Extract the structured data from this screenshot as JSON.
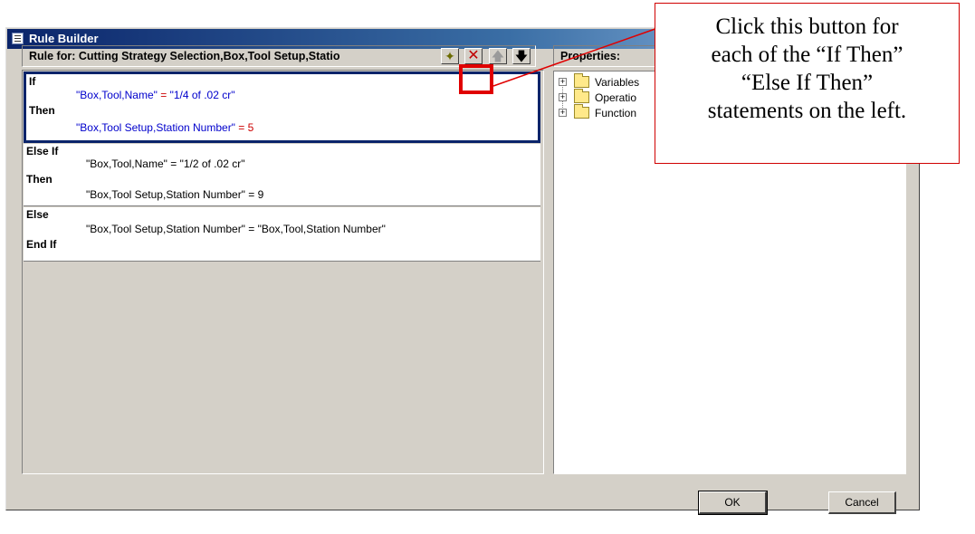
{
  "window": {
    "title": "Rule Builder"
  },
  "rule_panel": {
    "header": "Rule for: Cutting Strategy Selection,Box,Tool Setup,Statio",
    "toolbar": {
      "new_icon": "new-rule-icon",
      "delete_icon": "delete-x-icon",
      "move_up_icon": "arrow-up-icon",
      "move_down_icon": "arrow-down-icon"
    },
    "blocks": [
      {
        "keyword1": "If",
        "cond_lhs": "\"Box,Tool,Name\"",
        "cond_eq": " = ",
        "cond_rhs": "\"1/4 of .02 cr\"",
        "keyword2": "Then",
        "action_lhs": "\"Box,Tool Setup,Station Number\"",
        "action_eq": " = ",
        "action_rhs": "5"
      },
      {
        "keyword1": "Else If",
        "condition": "\"Box,Tool,Name\" = \"1/2 of .02 cr\"",
        "keyword2": "Then",
        "action": "\"Box,Tool Setup,Station Number\" = 9"
      },
      {
        "keyword1": "Else",
        "action": "\"Box,Tool Setup,Station Number\" = \"Box,Tool,Station Number\"",
        "keyword2": "End If"
      }
    ]
  },
  "properties_panel": {
    "header": "Properties:",
    "tree": [
      {
        "label": "Variables",
        "expander": "+"
      },
      {
        "label": "Operatio",
        "expander": "+"
      },
      {
        "label": "Function",
        "expander": "+"
      }
    ]
  },
  "buttons": {
    "ok": "OK",
    "cancel": "Cancel"
  },
  "callout": {
    "lines": [
      "Click this button for",
      "each of the “If Then”",
      "“Else If Then”",
      "statements on the left."
    ],
    "color": "#e00000"
  }
}
